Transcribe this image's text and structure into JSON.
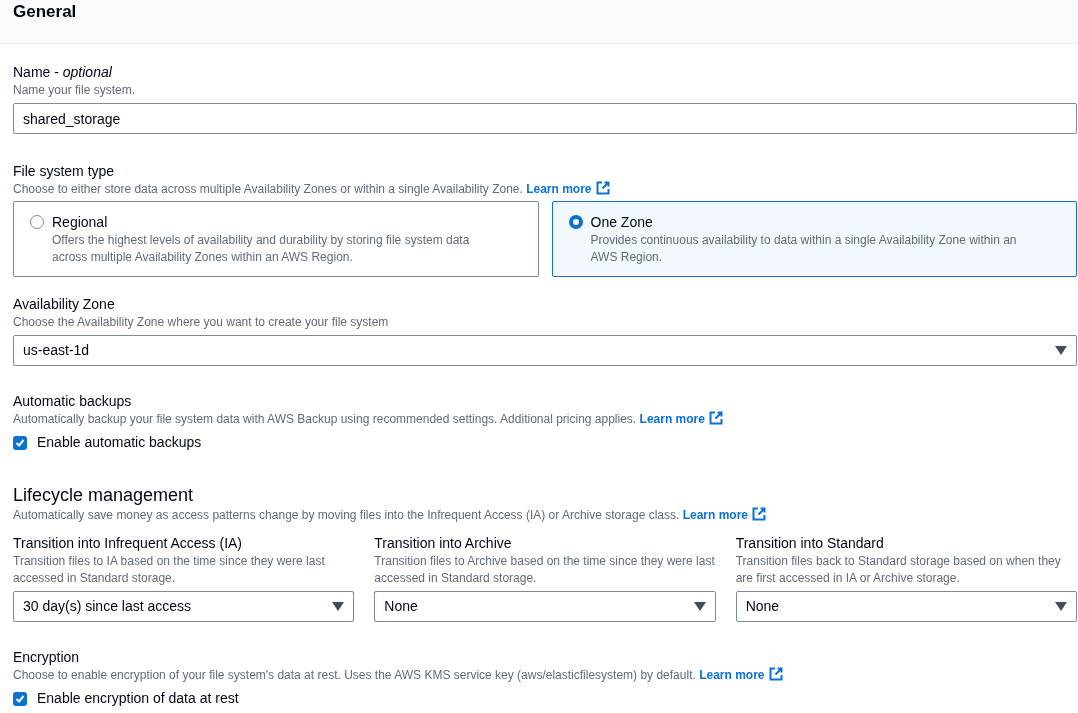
{
  "header": {
    "title": "General"
  },
  "name_field": {
    "label": "Name - *optional*",
    "description": "Name your file system.",
    "value": "shared_storage"
  },
  "file_system_type": {
    "label": "File system type",
    "description": "Choose to either store data across multiple Availability Zones or within a single Availability Zone.",
    "link": "Learn more",
    "options": [
      {
        "title": "Regional",
        "description": "Offers the highest levels of availability and durability by storing file system data across multiple Availability Zones within an AWS Region.",
        "selected": false
      },
      {
        "title": "One Zone",
        "description": "Provides continuous availability to data within a single Availability Zone within an AWS Region.",
        "selected": true
      }
    ]
  },
  "availability_zone": {
    "label": "Availability Zone",
    "description": "Choose the Availability Zone where you want to create your file system",
    "value": "us-east-1d"
  },
  "automatic_backups": {
    "label": "Automatic backups",
    "description": "Automatically backup your file system data with AWS Backup using recommended settings. Additional pricing applies.",
    "link": "Learn more",
    "checkbox": {
      "label": "Enable automatic backups",
      "checked": true
    }
  },
  "lifecycle": {
    "title": "Lifecycle management",
    "description": "Automatically save money as access patterns change by moving files into the Infrequent Access (IA) or Archive storage class.",
    "link": "Learn more",
    "transitions": [
      {
        "label": "Transition into Infrequent Access (IA)",
        "description": "Transition files to IA based on the time since they were last accessed in Standard storage.",
        "value": "30 day(s) since last access"
      },
      {
        "label": "Transition into Archive",
        "description": "Transition files to Archive based on the time since they were last accessed in Standard storage.",
        "value": "None"
      },
      {
        "label": "Transition into Standard",
        "description": "Transition files back to Standard storage based on when they are first accessed in IA or Archive storage.",
        "value": "None"
      }
    ]
  },
  "encryption": {
    "label": "Encryption",
    "description": "Choose to enable encryption of your file system's data at rest. Uses the AWS KMS service key (aws/elasticfilesystem) by default.",
    "link": "Learn more",
    "checkbox": {
      "label": "Enable encryption of data at rest",
      "checked": true
    }
  }
}
